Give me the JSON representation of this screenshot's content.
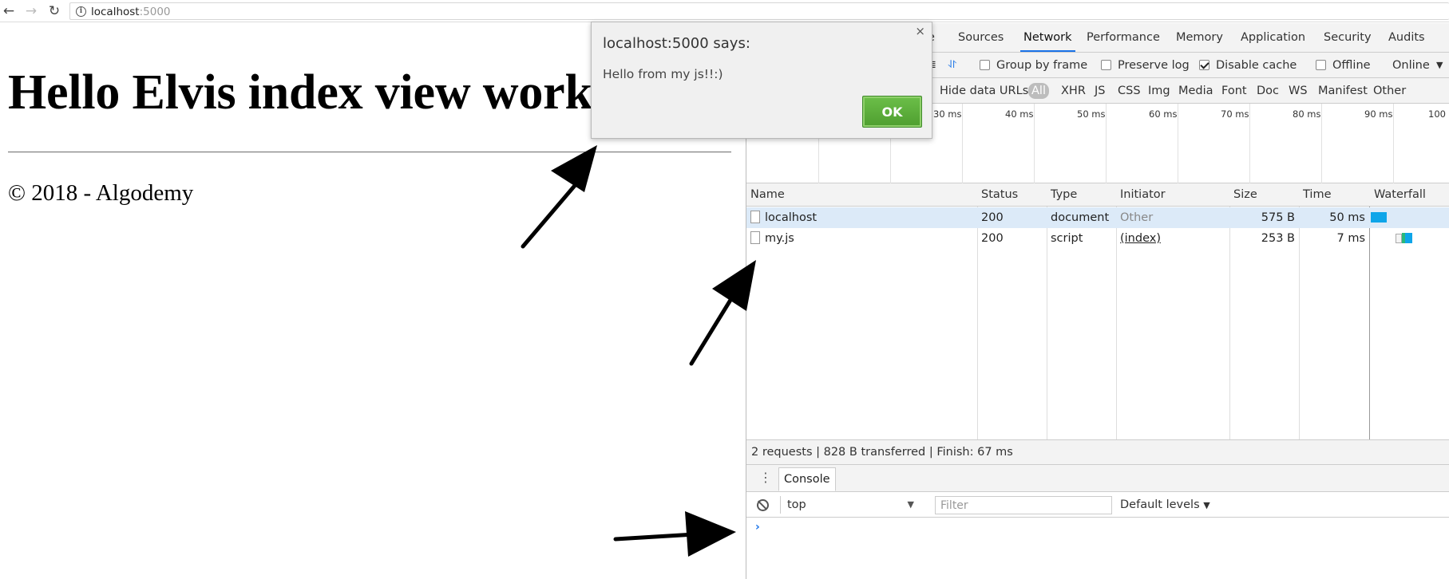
{
  "browser": {
    "url_host": "localhost",
    "url_port": ":5000"
  },
  "page": {
    "heading": "Hello Elvis index view working!",
    "footer": "© 2018 - Algodemy"
  },
  "devtools": {
    "tabs": [
      "e",
      "Sources",
      "Network",
      "Performance",
      "Memory",
      "Application",
      "Security",
      "Audits"
    ],
    "active_tab": "Network",
    "toolbar": {
      "group_by_frame": "Group by frame",
      "preserve_log": "Preserve log",
      "disable_cache": "Disable cache",
      "offline": "Offline",
      "throttle": "Online"
    },
    "filters": {
      "hide_data_urls": "Hide data URLs",
      "types": [
        "All",
        "XHR",
        "JS",
        "CSS",
        "Img",
        "Media",
        "Font",
        "Doc",
        "WS",
        "Manifest",
        "Other"
      ],
      "active": "All"
    },
    "overview_ticks": [
      "30 ms",
      "40 ms",
      "50 ms",
      "60 ms",
      "70 ms",
      "80 ms",
      "90 ms",
      "100"
    ],
    "table": {
      "columns": [
        "Name",
        "Status",
        "Type",
        "Initiator",
        "Size",
        "Time",
        "Waterfall"
      ],
      "rows": [
        {
          "name": "localhost",
          "status": "200",
          "type": "document",
          "initiator": "Other",
          "size": "575 B",
          "time": "50 ms"
        },
        {
          "name": "my.js",
          "status": "200",
          "type": "script",
          "initiator": "(index)",
          "size": "253 B",
          "time": "7 ms"
        }
      ]
    },
    "summary": "2 requests  |  828 B transferred  |  Finish: 67 ms",
    "console": {
      "tab_label": "Console",
      "context": "top",
      "filter_placeholder": "Filter",
      "levels": "Default levels",
      "prompt": "›"
    }
  },
  "alert": {
    "title": "localhost:5000 says:",
    "message": "Hello from my js!!:)",
    "ok_label": "OK",
    "close_glyph": "×"
  },
  "colors": {
    "accent": "#1a73e8",
    "ok_button": "#5aab38",
    "waterfall_bar": "#0ea5e9",
    "selected_row": "#dceaf8"
  }
}
